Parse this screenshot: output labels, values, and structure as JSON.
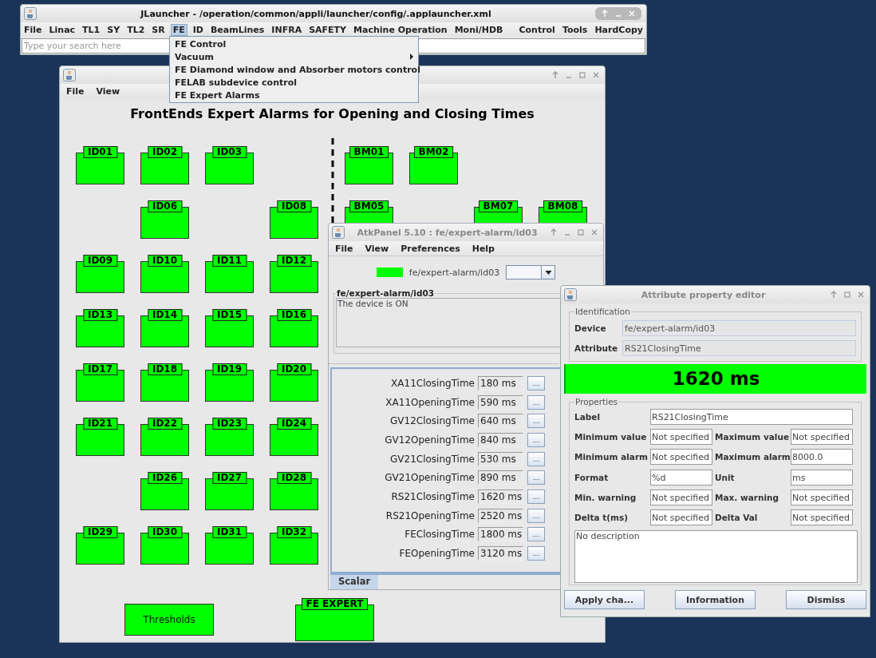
{
  "launcher": {
    "title": "JLauncher - /operation/common/appli/launcher/config/.applauncher.xml",
    "menus": [
      {
        "label": "File",
        "selected": false
      },
      {
        "label": "Linac",
        "selected": false
      },
      {
        "label": "TL1",
        "selected": false
      },
      {
        "label": "SY",
        "selected": false
      },
      {
        "label": "TL2",
        "selected": false
      },
      {
        "label": "SR",
        "selected": false
      },
      {
        "label": "FE",
        "selected": true
      },
      {
        "label": "ID",
        "selected": false
      },
      {
        "label": "BeamLines",
        "selected": false
      },
      {
        "label": "INFRA",
        "selected": false
      },
      {
        "label": "SAFETY",
        "selected": false
      },
      {
        "label": "Machine Operation",
        "selected": false
      },
      {
        "label": "Moni/HDB",
        "selected": false
      }
    ],
    "right_menus": [
      {
        "label": "Control",
        "selected": false
      },
      {
        "label": "Tools",
        "selected": false
      },
      {
        "label": "HardCopy",
        "selected": false
      }
    ],
    "search": {
      "placeholder": "Type your search here"
    },
    "dropdown": [
      {
        "label": "FE Control",
        "kind": "item"
      },
      {
        "label": "Vacuum",
        "kind": "submenu"
      },
      {
        "label": "FE Diamond window and Absorber motors control",
        "kind": "item"
      },
      {
        "label": "FELAB subdevice control",
        "kind": "item"
      },
      {
        "label": "FE Expert Alarms",
        "kind": "item"
      }
    ]
  },
  "synoptic": {
    "menus": [
      "File",
      "View"
    ],
    "heading": "FrontEnds Expert Alarms for Opening and Closing Times",
    "id_rows": [
      [
        "ID01",
        "ID02",
        "ID03",
        null
      ],
      [
        null,
        "ID06",
        null,
        "ID08"
      ],
      [
        "ID09",
        "ID10",
        "ID11",
        "ID12"
      ],
      [
        "ID13",
        "ID14",
        "ID15",
        "ID16"
      ],
      [
        "ID17",
        "ID18",
        "ID19",
        "ID20"
      ],
      [
        "ID21",
        "ID22",
        "ID23",
        "ID24"
      ],
      [
        null,
        "ID26",
        "ID27",
        "ID28"
      ],
      [
        "ID29",
        "ID30",
        "ID31",
        "ID32"
      ]
    ],
    "bm_rows": [
      [
        "BM01",
        "BM02",
        null,
        null
      ],
      [
        "BM05",
        null,
        "BM07",
        "BM08"
      ]
    ],
    "thresholds_button": "Thresholds",
    "expert_box": "FE EXPERT"
  },
  "atk_panel": {
    "title": "AtkPanel 5.10 : fe/expert-alarm/id03",
    "menus": [
      "File",
      "View",
      "Preferences",
      "Help"
    ],
    "state_device": "fe/expert-alarm/id03",
    "status_group": {
      "title": "fe/expert-alarm/id03",
      "text": "The device is ON"
    },
    "attributes": [
      {
        "name": "XA11ClosingTime",
        "value": "180 ms",
        "button": "..."
      },
      {
        "name": "XA11OpeningTime",
        "value": "590 ms",
        "button": "..."
      },
      {
        "name": "GV12ClosingTime",
        "value": "640 ms",
        "button": "..."
      },
      {
        "name": "GV12OpeningTime",
        "value": "840 ms",
        "button": "..."
      },
      {
        "name": "GV21ClosingTime",
        "value": "530 ms",
        "button": "..."
      },
      {
        "name": "GV21OpeningTime",
        "value": "890 ms",
        "button": "..."
      },
      {
        "name": "RS21ClosingTime",
        "value": "1620 ms",
        "button": "..."
      },
      {
        "name": "RS21OpeningTime",
        "value": "2520 ms",
        "button": "..."
      },
      {
        "name": "FEClosingTime",
        "value": "1800 ms",
        "button": "..."
      },
      {
        "name": "FEOpeningTime",
        "value": "3120 ms",
        "button": "..."
      }
    ],
    "tabs": [
      {
        "label": "Scalar",
        "selected": true
      }
    ]
  },
  "attribute_editor": {
    "title": "Attribute property editor",
    "identification": {
      "title": "Identification",
      "fields": [
        {
          "label": "Device",
          "value": "fe/expert-alarm/id03"
        },
        {
          "label": "Attribute",
          "value": "RS21ClosingTime"
        }
      ]
    },
    "value": "1620 ms",
    "properties": {
      "title": "Properties",
      "label_field": {
        "label": "Label",
        "value": "RS21ClosingTime"
      },
      "pairs": [
        [
          {
            "label": "Minimum value",
            "value": "Not specified"
          },
          {
            "label": "Maximum value",
            "value": "Not specified"
          }
        ],
        [
          {
            "label": "Minimum alarm",
            "value": "Not specified"
          },
          {
            "label": "Maximum alarm",
            "value": "8000.0"
          }
        ],
        [
          {
            "label": "Format",
            "value": "%d"
          },
          {
            "label": "Unit",
            "value": "ms"
          }
        ],
        [
          {
            "label": "Min. warning",
            "value": "Not specified"
          },
          {
            "label": "Max. warning",
            "value": "Not specified"
          }
        ],
        [
          {
            "label": "Delta t(ms)",
            "value": "Not specified"
          },
          {
            "label": "Delta Val",
            "value": "Not specified"
          }
        ]
      ],
      "description": "No description"
    },
    "buttons": [
      "Apply cha...",
      "Information",
      "Dismiss"
    ]
  }
}
